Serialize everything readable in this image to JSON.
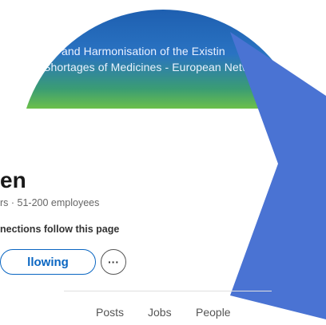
{
  "banner": {
    "line1": "ion and Harmonisation of the Existin",
    "line2": "Shortages of Medicines - European Netwo"
  },
  "company": {
    "name": "en",
    "meta": "rs · 51-200 employees",
    "followers_text": "nections follow this page"
  },
  "actions": {
    "following_label": "llowing",
    "more_label": "···"
  },
  "tabs": [
    {
      "label": "Posts"
    },
    {
      "label": "Jobs"
    },
    {
      "label": "People"
    }
  ]
}
